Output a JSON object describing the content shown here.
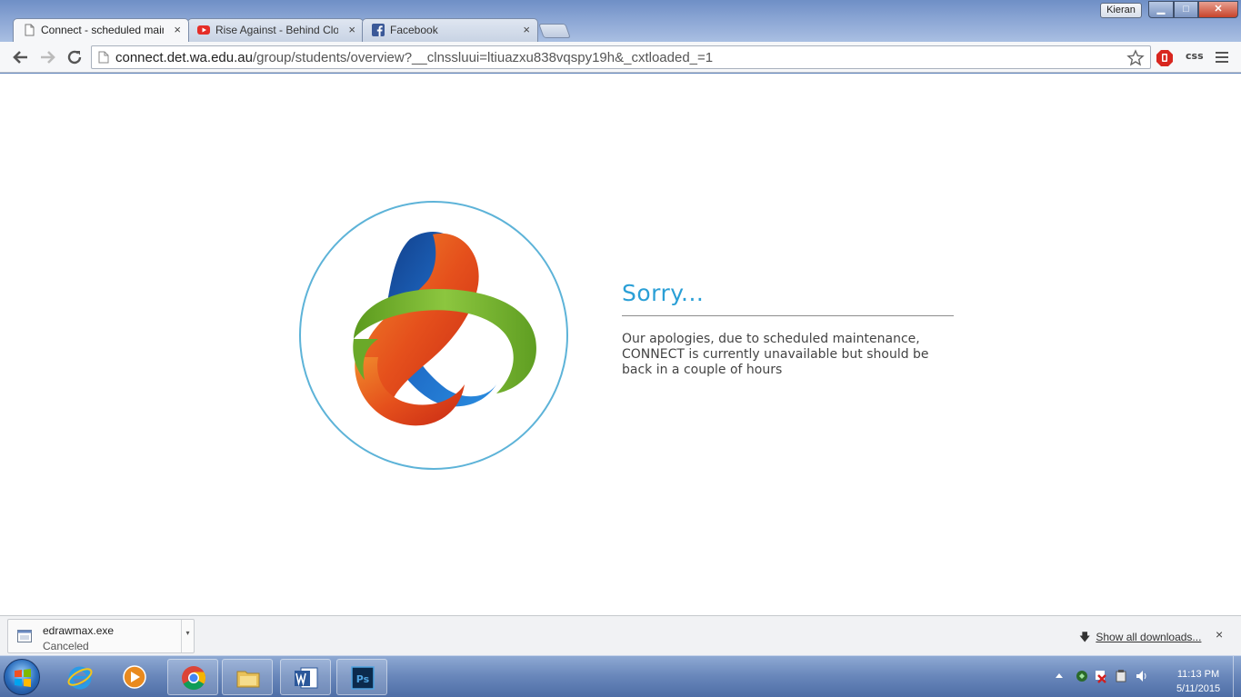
{
  "window": {
    "profile_name": "Kieran",
    "controls": {
      "minimize": "▁",
      "maximize": "□",
      "close": "✕"
    }
  },
  "tabs": [
    {
      "title": "Connect - scheduled maintenance",
      "icon": "page-icon",
      "active": true,
      "close": "×"
    },
    {
      "title": "Rise Against - Behind Closed Doors",
      "icon": "youtube-icon",
      "active": false,
      "close": "×"
    },
    {
      "title": "Facebook",
      "icon": "facebook-icon",
      "active": false,
      "close": "×"
    }
  ],
  "toolbar": {
    "url_host": "connect.det.wa.edu.au",
    "url_path": "/group/students/overview?__clnssluui=ltiuazxu838vqspy19h&_cxtloaded_=1",
    "extension_css_label": "css"
  },
  "page": {
    "title": "Sorry...",
    "message_lines": [
      "Our apologies, due to scheduled maintenance,",
      "CONNECT is currently unavailable but should be",
      "back in a couple of hours"
    ],
    "colors": {
      "accent": "#2a9fd6",
      "circle": "#5db3d8",
      "blue": "#1f5fb3",
      "orange": "#e8561f",
      "green": "#7cb82f"
    }
  },
  "downloads": {
    "file_name": "edrawmax.exe",
    "status": "Canceled",
    "show_all": "Show all downloads...",
    "close": "×"
  },
  "taskbar": {
    "apps": [
      "internet-explorer-icon",
      "media-player-icon",
      "chrome-icon",
      "file-explorer-icon",
      "word-icon",
      "photoshop-icon"
    ],
    "time": "11:13 PM",
    "date": "5/11/2015"
  }
}
